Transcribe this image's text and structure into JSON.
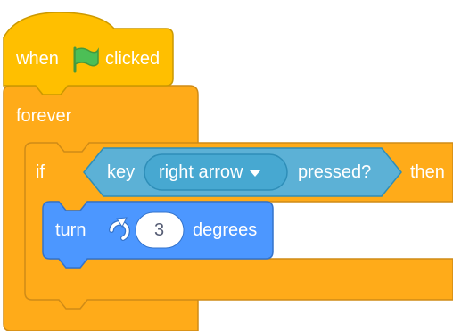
{
  "colors": {
    "events": "#FFBF00",
    "control": "#FFAB19",
    "sensing": "#5CB1D6",
    "motion": "#4C97FF",
    "flag": "#4CBF56"
  },
  "event_block": {
    "before_flag": "when",
    "flag_icon": "green-flag-icon",
    "after_flag": "clicked"
  },
  "forever_block": {
    "label": "forever"
  },
  "if_block": {
    "if_label": "if",
    "then_label": "then"
  },
  "sensing_block": {
    "key_label": "key",
    "key_value": "right arrow",
    "pressed_label": "pressed?"
  },
  "motion_block": {
    "turn_label": "turn",
    "rotate_icon": "rotate-right-icon",
    "degrees_value": "3",
    "degrees_label": "degrees"
  }
}
